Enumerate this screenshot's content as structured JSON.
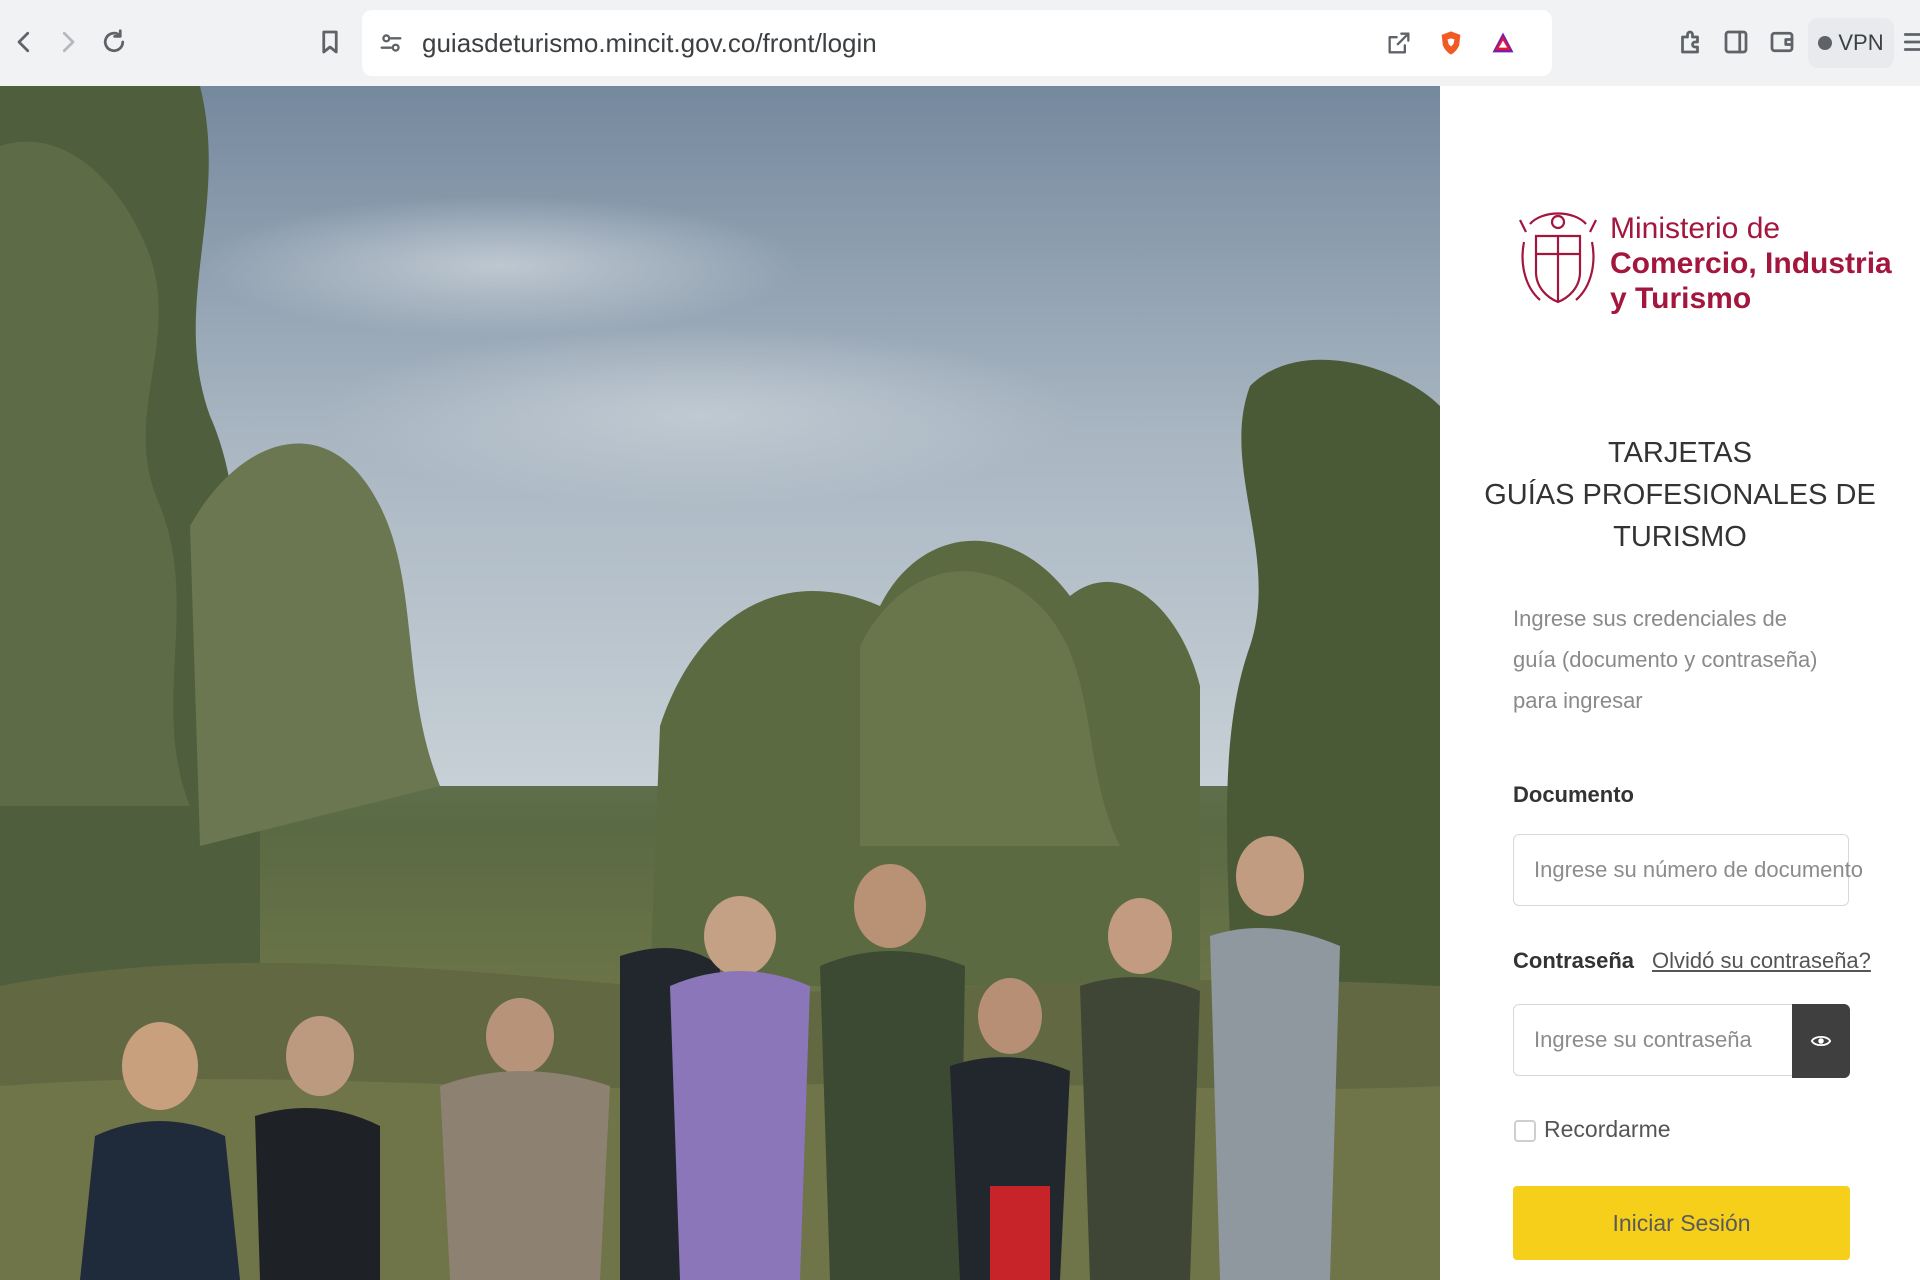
{
  "browser": {
    "url": "guiasdeturismo.mincit.gov.co/front/login",
    "vpn_label": "VPN"
  },
  "logo": {
    "line1": "Ministerio de",
    "line2": "Comercio, Industria",
    "line3": "y Turismo"
  },
  "title": {
    "line1": "TARJETAS",
    "line2": "GUÍAS PROFESIONALES DE",
    "line3": "TURISMO"
  },
  "description": "Ingrese sus credenciales de guía (documento y contraseña) para ingresar",
  "form": {
    "document_label": "Documento",
    "document_placeholder": "Ingrese su número de documento",
    "password_label": "Contraseña",
    "forgot_link": "Olvidó su contraseña?",
    "password_placeholder": "Ingrese su contraseña",
    "remember_label": "Recordarme",
    "submit_label": "Iniciar Sesión"
  },
  "colors": {
    "brand": "#a3163e",
    "button": "#f6cf1b"
  }
}
